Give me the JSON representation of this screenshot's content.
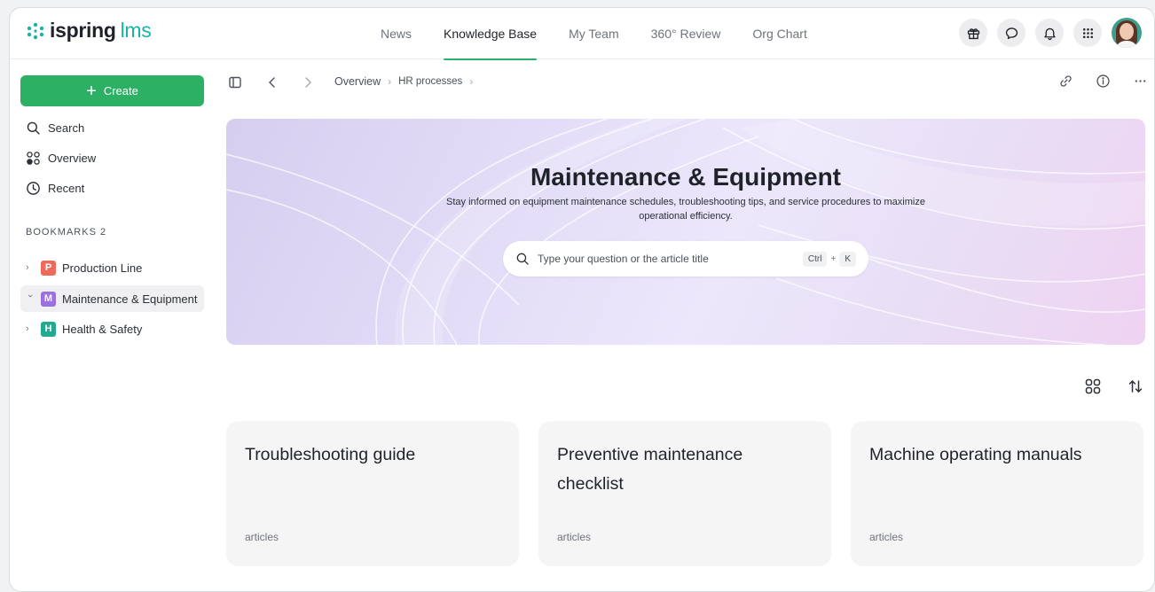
{
  "brand": {
    "name": "ispring",
    "product": "lms",
    "accent": "#2cb164",
    "logo_color": "#19b4a6"
  },
  "nav": {
    "items": [
      {
        "label": "News",
        "active": false
      },
      {
        "label": "Knowledge Base",
        "active": true
      },
      {
        "label": "My Team",
        "active": false
      },
      {
        "label": "360° Review",
        "active": false
      },
      {
        "label": "Org Chart",
        "active": false
      }
    ]
  },
  "top_icons": [
    "gift-icon",
    "chat-icon",
    "bell-icon",
    "apps-grid-icon"
  ],
  "sidebar": {
    "create_label": "Create",
    "links": [
      {
        "label": "Search",
        "icon": "search-icon"
      },
      {
        "label": "Overview",
        "icon": "overview-icon"
      },
      {
        "label": "Recent",
        "icon": "clock-icon"
      }
    ],
    "bookmarks_title": "BOOKMARKS 2",
    "bookmarks": [
      {
        "letter": "P",
        "label": "Production Line",
        "color": "#ee6b5b",
        "expanded": false,
        "selected": false
      },
      {
        "letter": "M",
        "label": "Maintenance & Equipment",
        "color": "#9b6fe0",
        "expanded": true,
        "selected": true
      },
      {
        "letter": "H",
        "label": "Health & Safety",
        "color": "#22a98f",
        "expanded": false,
        "selected": false
      }
    ]
  },
  "breadcrumb": {
    "items": [
      "Overview",
      "HR processes"
    ]
  },
  "hero": {
    "title": "Maintenance & Equipment",
    "subtitle": "Stay informed on equipment maintenance schedules, troubleshooting tips, and service procedures to maximize operational efficiency.",
    "search_placeholder": "Type your question or the article title",
    "shortcut_key1": "Ctrl",
    "shortcut_plus": "+",
    "shortcut_key2": "K"
  },
  "cards": [
    {
      "title": "Troubleshooting guide",
      "meta": "articles"
    },
    {
      "title": "Preventive maintenance checklist",
      "meta": "articles"
    },
    {
      "title": "Machine operating manuals",
      "meta": "articles"
    }
  ]
}
